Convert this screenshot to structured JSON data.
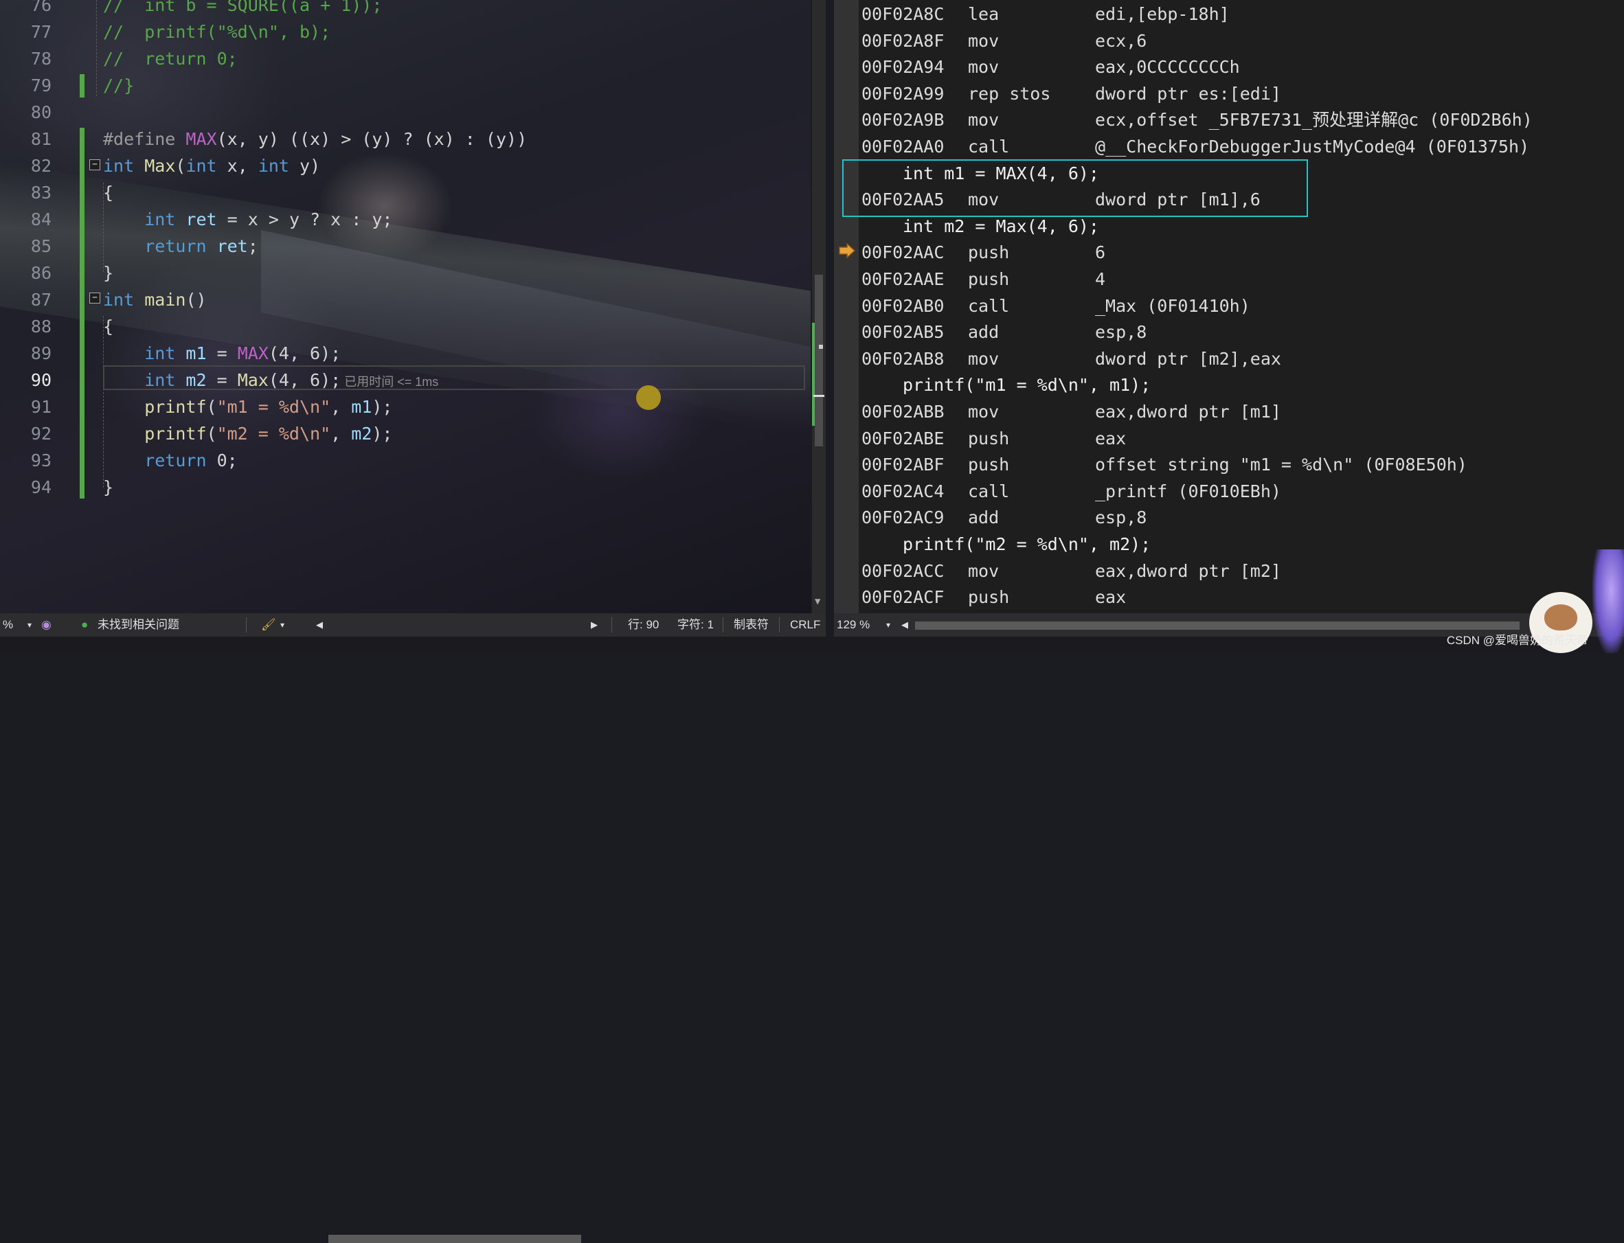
{
  "editor": {
    "lines": [
      {
        "num": "76",
        "segs": [
          [
            "c",
            "//  int b = SQURE((a + 1));"
          ]
        ]
      },
      {
        "num": "77",
        "segs": [
          [
            "c",
            "//  printf(\"%d\\n\", b);"
          ]
        ]
      },
      {
        "num": "78",
        "segs": [
          [
            "c",
            "//  return 0;"
          ]
        ]
      },
      {
        "num": "79",
        "segs": [
          [
            "c",
            "//}"
          ]
        ]
      },
      {
        "num": "80",
        "segs": []
      },
      {
        "num": "81",
        "segs": [
          [
            "p",
            "#define "
          ],
          [
            "m",
            "MAX"
          ],
          [
            "t",
            "(x, y) ((x) > (y) ? (x) : (y))"
          ]
        ]
      },
      {
        "num": "82",
        "segs": [
          [
            "k",
            "int "
          ],
          [
            "f",
            "Max"
          ],
          [
            "t",
            "("
          ],
          [
            "k",
            "int "
          ],
          [
            "t",
            "x, "
          ],
          [
            "k",
            "int "
          ],
          [
            "t",
            "y)"
          ]
        ]
      },
      {
        "num": "83",
        "segs": [
          [
            "t",
            "{"
          ]
        ]
      },
      {
        "num": "84",
        "segs": [
          [
            "k",
            "    int "
          ],
          [
            "v",
            "ret "
          ],
          [
            "t",
            "= x > y ? x : y;"
          ]
        ]
      },
      {
        "num": "85",
        "segs": [
          [
            "k",
            "    return "
          ],
          [
            "v",
            "ret"
          ],
          [
            "t",
            ";"
          ]
        ]
      },
      {
        "num": "86",
        "segs": [
          [
            "t",
            "}"
          ]
        ]
      },
      {
        "num": "87",
        "segs": [
          [
            "k",
            "int "
          ],
          [
            "f",
            "main"
          ],
          [
            "t",
            "()"
          ]
        ]
      },
      {
        "num": "88",
        "segs": [
          [
            "t",
            "{"
          ]
        ]
      },
      {
        "num": "89",
        "segs": [
          [
            "k",
            "    int "
          ],
          [
            "v",
            "m1 "
          ],
          [
            "t",
            "= "
          ],
          [
            "m",
            "MAX"
          ],
          [
            "t",
            "(4, 6);"
          ]
        ]
      },
      {
        "num": "90",
        "segs": [
          [
            "k",
            "    int "
          ],
          [
            "v",
            "m2 "
          ],
          [
            "t",
            "= "
          ],
          [
            "f",
            "Max"
          ],
          [
            "t",
            "(4, 6);"
          ],
          [
            "h",
            " 已用时间 <= 1ms"
          ]
        ]
      },
      {
        "num": "91",
        "segs": [
          [
            "f",
            "    printf"
          ],
          [
            "t",
            "("
          ],
          [
            "s",
            "\"m1 = %d\\n\""
          ],
          [
            "t",
            ", "
          ],
          [
            "v",
            "m1"
          ],
          [
            "t",
            ");"
          ]
        ]
      },
      {
        "num": "92",
        "segs": [
          [
            "f",
            "    printf"
          ],
          [
            "t",
            "("
          ],
          [
            "s",
            "\"m2 = %d\\n\""
          ],
          [
            "t",
            ", "
          ],
          [
            "v",
            "m2"
          ],
          [
            "t",
            ");"
          ]
        ]
      },
      {
        "num": "93",
        "segs": [
          [
            "k",
            "    return "
          ],
          [
            "t",
            "0;"
          ]
        ]
      },
      {
        "num": "94",
        "segs": [
          [
            "t",
            "}"
          ]
        ]
      }
    ],
    "current_line": "90"
  },
  "disassembly": {
    "rows": [
      {
        "addr": "00F02A8C",
        "op": "lea",
        "arg": "edi,[ebp-18h]"
      },
      {
        "addr": "00F02A8F",
        "op": "mov",
        "arg": "ecx,6"
      },
      {
        "addr": "00F02A94",
        "op": "mov",
        "arg": "eax,0CCCCCCCCh"
      },
      {
        "addr": "00F02A99",
        "op": "rep stos",
        "arg": "dword ptr es:[edi]"
      },
      {
        "addr": "00F02A9B",
        "op": "mov",
        "arg": "ecx,offset _5FB7E731_预处理详解@c (0F0D2B6h)"
      },
      {
        "addr": "00F02AA0",
        "op": "call",
        "arg": "@__CheckForDebuggerJustMyCode@4 (0F01375h)"
      },
      {
        "src": "int m1 = MAX(4, 6);"
      },
      {
        "addr": "00F02AA5",
        "op": "mov",
        "arg": "dword ptr [m1],6"
      },
      {
        "src": "int m2 = Max(4, 6);"
      },
      {
        "addr": "00F02AAC",
        "op": "push",
        "arg": "6"
      },
      {
        "addr": "00F02AAE",
        "op": "push",
        "arg": "4"
      },
      {
        "addr": "00F02AB0",
        "op": "call",
        "arg": "_Max (0F01410h)"
      },
      {
        "addr": "00F02AB5",
        "op": "add",
        "arg": "esp,8"
      },
      {
        "addr": "00F02AB8",
        "op": "mov",
        "arg": "dword ptr [m2],eax"
      },
      {
        "src": "printf(\"m1 = %d\\n\", m1);"
      },
      {
        "addr": "00F02ABB",
        "op": "mov",
        "arg": "eax,dword ptr [m1]"
      },
      {
        "addr": "00F02ABE",
        "op": "push",
        "arg": "eax"
      },
      {
        "addr": "00F02ABF",
        "op": "push",
        "arg": "offset string \"m1 = %d\\n\" (0F08E50h)"
      },
      {
        "addr": "00F02AC4",
        "op": "call",
        "arg": "_printf (0F010EBh)"
      },
      {
        "addr": "00F02AC9",
        "op": "add",
        "arg": "esp,8"
      },
      {
        "src": "printf(\"m2 = %d\\n\", m2);"
      },
      {
        "addr": "00F02ACC",
        "op": "mov",
        "arg": "eax,dword ptr [m2]"
      },
      {
        "addr": "00F02ACF",
        "op": "push",
        "arg": "eax"
      }
    ]
  },
  "status_left": {
    "zoom": "%",
    "issues": "未找到相关问题",
    "line": "行: 90",
    "col": "字符: 1",
    "tabs": "制表符",
    "eol": "CRLF"
  },
  "status_right": {
    "zoom": "129 %"
  },
  "watermark": "CSDN @爱喝兽奶的荒天帝",
  "colors": {
    "accent_highlight": "#22c4c8",
    "green_change": "#57a64a",
    "ip_arrow": "#e8a33c"
  }
}
